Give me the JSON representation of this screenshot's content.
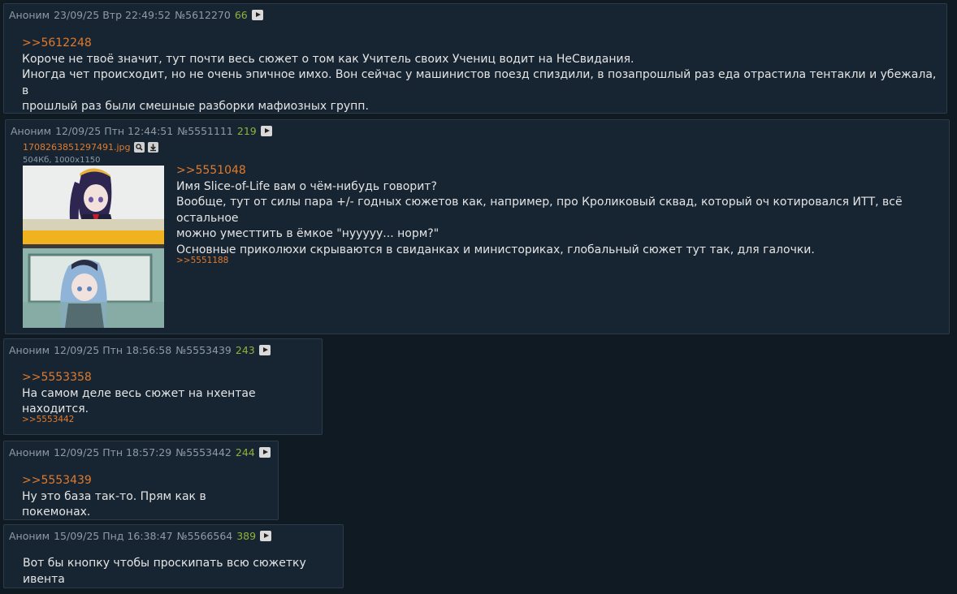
{
  "posts": [
    {
      "author": "Аноним",
      "date": "23/09/25 Втр 22:49:52",
      "num": "№5612270",
      "count": "66",
      "ref": ">>5612248",
      "lines": [
        "Короче не твоё значит, тут почти весь сюжет о том как Учитель своих Учениц водит на НеСвидания.",
        "Иногда чет происходит, но не очень эпичное имхо. Вон сейчас у машинистов поезд спиздили, в позапрошлый раз еда отрастила тентакли и убежала, в",
        "прошлый раз были смешные разборки мафиозных групп."
      ]
    },
    {
      "author": "Аноним",
      "date": "12/09/25 Птн 12:44:51",
      "num": "№5551111",
      "count": "219",
      "file_name": "1708263851297491.jpg",
      "file_info": "504Кб, 1000x1150",
      "ref": ">>5551048",
      "lines": [
        "Имя Slice-of-Life вам о чём-нибудь говорит?",
        "Вообще, тут от силы пара +/- годных сюжетов как, например, про Кроликовый сквад, который оч котировался ИТТ, всё остальное",
        "можно уместтить в ёмкое \"нууууу... норм?\"",
        "Основные приколюхи скрываются в свиданках и министориках, глобальный сюжет тут так, для галочки."
      ],
      "reply": ">>5551188"
    },
    {
      "author": "Аноним",
      "date": "12/09/25 Птн 18:56:58",
      "num": "№5553439",
      "count": "243",
      "ref": ">>5553358",
      "lines": [
        "На самом деле весь сюжет на нхентае находится."
      ],
      "reply": ">>5553442"
    },
    {
      "author": "Аноним",
      "date": "12/09/25 Птн 18:57:29",
      "num": "№5553442",
      "count": "244",
      "ref": ">>5553439",
      "lines": [
        "Ну это база так-то. Прям как в покемонах."
      ]
    },
    {
      "author": "Аноним",
      "date": "15/09/25 Пнд 16:38:47",
      "num": "№5566564",
      "count": "389",
      "lines": [
        "Вот бы кнопку чтобы проскипать всю сюжетку ивента"
      ]
    }
  ],
  "colors": {
    "background": "#0f1a23",
    "post_bg": "#172533",
    "link": "#e07a2c",
    "counter": "#8fb33a"
  }
}
